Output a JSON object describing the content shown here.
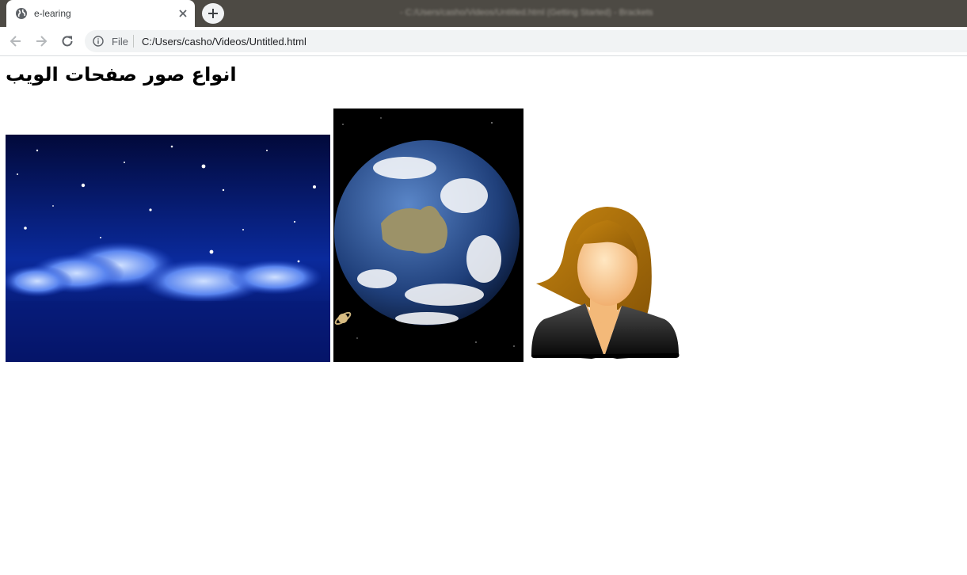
{
  "browser": {
    "tab_title": "e-learing",
    "window_title": "- C:/Users/casho/Videos/Untitled.html (Getting Started) - Brackets",
    "omnibox": {
      "scheme": "File",
      "url": "C:/Users/casho/Videos/Untitled.html"
    },
    "icons": [
      "globe-icon",
      "close-icon",
      "plus-icon",
      "back-icon",
      "forward-icon",
      "reload-icon",
      "info-icon"
    ]
  },
  "page": {
    "heading": "انواع صور صفحات الويب",
    "images": [
      {
        "subject": "night-sky-moon"
      },
      {
        "subject": "earth-from-space"
      },
      {
        "subject": "female-avatar"
      }
    ]
  },
  "colors": {
    "tabstrip": "#4d4a44",
    "omnibox": "#f1f3f4",
    "icon_gray": "#5f6368"
  }
}
